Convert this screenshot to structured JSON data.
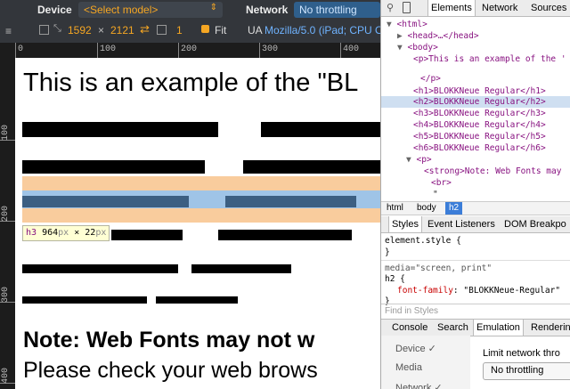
{
  "toolbar": {
    "device_label": "Device",
    "model_select": "<Select model>",
    "width": "1592",
    "times": "×",
    "height": "2121",
    "scale": "1",
    "fit_label": "Fit",
    "network_label": "Network",
    "network_select": "No throttling",
    "ua_label": "UA",
    "ua_value": "Mozilla/5.0 (iPad; CPU O"
  },
  "ruler": {
    "h": [
      "0",
      "100",
      "200",
      "300",
      "400"
    ],
    "v": [
      "100",
      "200",
      "300",
      "400"
    ]
  },
  "page": {
    "heading": "This is an example of the \"BL",
    "tooltip_tag": "h3",
    "tooltip_w": "964",
    "tooltip_h": "22",
    "tooltip_unit": "px",
    "tooltip_x": "×",
    "note": "Note: Web Fonts may not w",
    "check": "Please check your web brows"
  },
  "devtools": {
    "tabs": [
      "Elements",
      "Network",
      "Sources"
    ],
    "dom": [
      "<html>",
      "<head>…</head>",
      "<body>",
      "<p>This is an example of the '",
      "</p>",
      "<h1>BLOKKNeue Regular</h1>",
      "<h2>BLOKKNeue Regular</h2>",
      "<h3>BLOKKNeue Regular</h3>",
      "<h4>BLOKKNeue Regular</h4>",
      "<h5>BLOKKNeue Regular</h5>",
      "<h6>BLOKKNeue Regular</h6>",
      "<p>",
      "<strong>Note: Web Fonts may",
      "<br>",
      "\""
    ],
    "breadcrumb": [
      "html",
      "body",
      "h2"
    ],
    "style_tabs": [
      "Styles",
      "Event Listeners",
      "DOM Breakpo"
    ],
    "styles": {
      "element_style": "element.style {",
      "close1": "}",
      "media": "media=\"screen, print\"",
      "selector": "h2 {",
      "prop": "font-family",
      "value": "\"BLOKKNeue-Regular\"",
      "close2": "}"
    },
    "find_placeholder": "Find in Styles",
    "drawer_tabs": [
      "Console",
      "Search",
      "Emulation",
      "Renderin"
    ],
    "emulation_items": [
      "Device ✓",
      "Media",
      "Network ✓"
    ],
    "limit_label": "Limit network thro",
    "limit_select": "No throttling"
  }
}
